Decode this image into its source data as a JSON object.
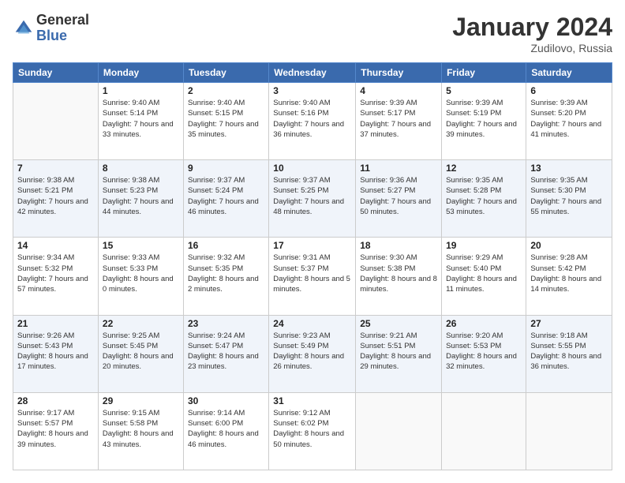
{
  "header": {
    "logo_line1": "General",
    "logo_line2": "Blue",
    "month_title": "January 2024",
    "location": "Zudilovo, Russia"
  },
  "weekdays": [
    "Sunday",
    "Monday",
    "Tuesday",
    "Wednesday",
    "Thursday",
    "Friday",
    "Saturday"
  ],
  "weeks": [
    [
      {
        "day": "",
        "sunrise": "",
        "sunset": "",
        "daylight": ""
      },
      {
        "day": "1",
        "sunrise": "Sunrise: 9:40 AM",
        "sunset": "Sunset: 5:14 PM",
        "daylight": "Daylight: 7 hours and 33 minutes."
      },
      {
        "day": "2",
        "sunrise": "Sunrise: 9:40 AM",
        "sunset": "Sunset: 5:15 PM",
        "daylight": "Daylight: 7 hours and 35 minutes."
      },
      {
        "day": "3",
        "sunrise": "Sunrise: 9:40 AM",
        "sunset": "Sunset: 5:16 PM",
        "daylight": "Daylight: 7 hours and 36 minutes."
      },
      {
        "day": "4",
        "sunrise": "Sunrise: 9:39 AM",
        "sunset": "Sunset: 5:17 PM",
        "daylight": "Daylight: 7 hours and 37 minutes."
      },
      {
        "day": "5",
        "sunrise": "Sunrise: 9:39 AM",
        "sunset": "Sunset: 5:19 PM",
        "daylight": "Daylight: 7 hours and 39 minutes."
      },
      {
        "day": "6",
        "sunrise": "Sunrise: 9:39 AM",
        "sunset": "Sunset: 5:20 PM",
        "daylight": "Daylight: 7 hours and 41 minutes."
      }
    ],
    [
      {
        "day": "7",
        "sunrise": "Sunrise: 9:38 AM",
        "sunset": "Sunset: 5:21 PM",
        "daylight": "Daylight: 7 hours and 42 minutes."
      },
      {
        "day": "8",
        "sunrise": "Sunrise: 9:38 AM",
        "sunset": "Sunset: 5:23 PM",
        "daylight": "Daylight: 7 hours and 44 minutes."
      },
      {
        "day": "9",
        "sunrise": "Sunrise: 9:37 AM",
        "sunset": "Sunset: 5:24 PM",
        "daylight": "Daylight: 7 hours and 46 minutes."
      },
      {
        "day": "10",
        "sunrise": "Sunrise: 9:37 AM",
        "sunset": "Sunset: 5:25 PM",
        "daylight": "Daylight: 7 hours and 48 minutes."
      },
      {
        "day": "11",
        "sunrise": "Sunrise: 9:36 AM",
        "sunset": "Sunset: 5:27 PM",
        "daylight": "Daylight: 7 hours and 50 minutes."
      },
      {
        "day": "12",
        "sunrise": "Sunrise: 9:35 AM",
        "sunset": "Sunset: 5:28 PM",
        "daylight": "Daylight: 7 hours and 53 minutes."
      },
      {
        "day": "13",
        "sunrise": "Sunrise: 9:35 AM",
        "sunset": "Sunset: 5:30 PM",
        "daylight": "Daylight: 7 hours and 55 minutes."
      }
    ],
    [
      {
        "day": "14",
        "sunrise": "Sunrise: 9:34 AM",
        "sunset": "Sunset: 5:32 PM",
        "daylight": "Daylight: 7 hours and 57 minutes."
      },
      {
        "day": "15",
        "sunrise": "Sunrise: 9:33 AM",
        "sunset": "Sunset: 5:33 PM",
        "daylight": "Daylight: 8 hours and 0 minutes."
      },
      {
        "day": "16",
        "sunrise": "Sunrise: 9:32 AM",
        "sunset": "Sunset: 5:35 PM",
        "daylight": "Daylight: 8 hours and 2 minutes."
      },
      {
        "day": "17",
        "sunrise": "Sunrise: 9:31 AM",
        "sunset": "Sunset: 5:37 PM",
        "daylight": "Daylight: 8 hours and 5 minutes."
      },
      {
        "day": "18",
        "sunrise": "Sunrise: 9:30 AM",
        "sunset": "Sunset: 5:38 PM",
        "daylight": "Daylight: 8 hours and 8 minutes."
      },
      {
        "day": "19",
        "sunrise": "Sunrise: 9:29 AM",
        "sunset": "Sunset: 5:40 PM",
        "daylight": "Daylight: 8 hours and 11 minutes."
      },
      {
        "day": "20",
        "sunrise": "Sunrise: 9:28 AM",
        "sunset": "Sunset: 5:42 PM",
        "daylight": "Daylight: 8 hours and 14 minutes."
      }
    ],
    [
      {
        "day": "21",
        "sunrise": "Sunrise: 9:26 AM",
        "sunset": "Sunset: 5:43 PM",
        "daylight": "Daylight: 8 hours and 17 minutes."
      },
      {
        "day": "22",
        "sunrise": "Sunrise: 9:25 AM",
        "sunset": "Sunset: 5:45 PM",
        "daylight": "Daylight: 8 hours and 20 minutes."
      },
      {
        "day": "23",
        "sunrise": "Sunrise: 9:24 AM",
        "sunset": "Sunset: 5:47 PM",
        "daylight": "Daylight: 8 hours and 23 minutes."
      },
      {
        "day": "24",
        "sunrise": "Sunrise: 9:23 AM",
        "sunset": "Sunset: 5:49 PM",
        "daylight": "Daylight: 8 hours and 26 minutes."
      },
      {
        "day": "25",
        "sunrise": "Sunrise: 9:21 AM",
        "sunset": "Sunset: 5:51 PM",
        "daylight": "Daylight: 8 hours and 29 minutes."
      },
      {
        "day": "26",
        "sunrise": "Sunrise: 9:20 AM",
        "sunset": "Sunset: 5:53 PM",
        "daylight": "Daylight: 8 hours and 32 minutes."
      },
      {
        "day": "27",
        "sunrise": "Sunrise: 9:18 AM",
        "sunset": "Sunset: 5:55 PM",
        "daylight": "Daylight: 8 hours and 36 minutes."
      }
    ],
    [
      {
        "day": "28",
        "sunrise": "Sunrise: 9:17 AM",
        "sunset": "Sunset: 5:57 PM",
        "daylight": "Daylight: 8 hours and 39 minutes."
      },
      {
        "day": "29",
        "sunrise": "Sunrise: 9:15 AM",
        "sunset": "Sunset: 5:58 PM",
        "daylight": "Daylight: 8 hours and 43 minutes."
      },
      {
        "day": "30",
        "sunrise": "Sunrise: 9:14 AM",
        "sunset": "Sunset: 6:00 PM",
        "daylight": "Daylight: 8 hours and 46 minutes."
      },
      {
        "day": "31",
        "sunrise": "Sunrise: 9:12 AM",
        "sunset": "Sunset: 6:02 PM",
        "daylight": "Daylight: 8 hours and 50 minutes."
      },
      {
        "day": "",
        "sunrise": "",
        "sunset": "",
        "daylight": ""
      },
      {
        "day": "",
        "sunrise": "",
        "sunset": "",
        "daylight": ""
      },
      {
        "day": "",
        "sunrise": "",
        "sunset": "",
        "daylight": ""
      }
    ]
  ]
}
